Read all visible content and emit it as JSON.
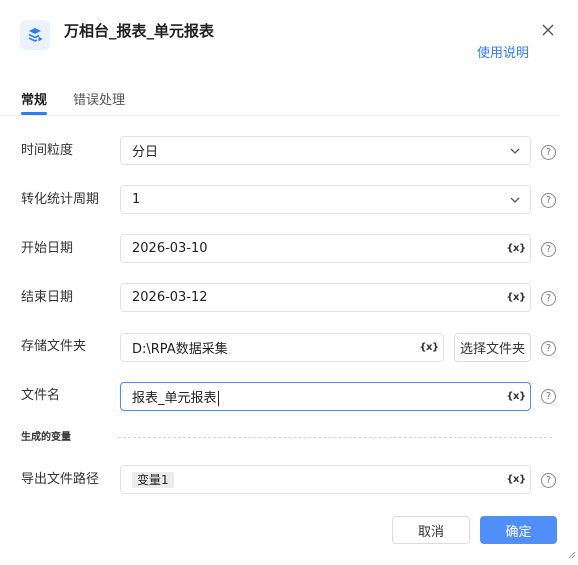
{
  "header": {
    "title": "万相台_报表_单元报表",
    "help_link": "使用说明",
    "icon": "rpa-app-icon"
  },
  "tabs": [
    {
      "label": "常规",
      "active": true
    },
    {
      "label": "错误处理",
      "active": false
    }
  ],
  "form": {
    "time_granularity": {
      "label": "时间粒度",
      "value": "分日"
    },
    "conversion_period": {
      "label": "转化统计周期",
      "value": "1"
    },
    "start_date": {
      "label": "开始日期",
      "value": "2026-03-10"
    },
    "end_date": {
      "label": "结束日期",
      "value": "2026-03-12"
    },
    "storage_folder": {
      "label": "存储文件夹",
      "value": "D:\\RPA数据采集",
      "button": "选择文件夹"
    },
    "file_name": {
      "label": "文件名",
      "value": "报表_单元报表"
    },
    "variable_button": "{x}",
    "help_mark": "?"
  },
  "generated_vars": {
    "section_label": "生成的变量",
    "export_path": {
      "label": "导出文件路径",
      "value": "变量1"
    }
  },
  "footer": {
    "cancel": "取消",
    "confirm": "确定"
  },
  "colors": {
    "accent": "#2f7cf6",
    "primary_button": "#4f8ff7"
  }
}
